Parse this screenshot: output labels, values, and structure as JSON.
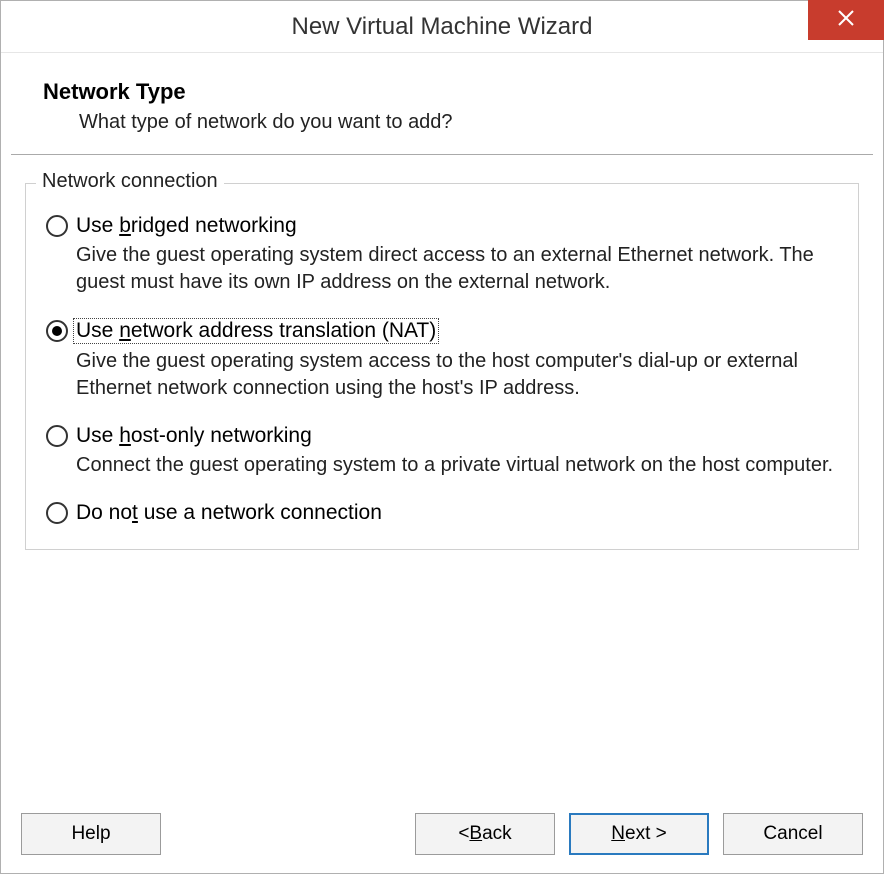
{
  "window": {
    "title": "New Virtual Machine Wizard"
  },
  "header": {
    "heading": "Network Type",
    "subtitle": "What type of network do you want to add?"
  },
  "group": {
    "legend": "Network connection",
    "options": [
      {
        "label_pre": "Use ",
        "mnemonic": "b",
        "label_post": "ridged networking",
        "description": "Give the guest operating system direct access to an external Ethernet network. The guest must have its own IP address on the external network.",
        "selected": false,
        "focused": false
      },
      {
        "label_pre": "Use ",
        "mnemonic": "n",
        "label_post": "etwork address translation (NAT)",
        "description": "Give the guest operating system access to the host computer's dial-up or external Ethernet network connection using the host's IP address.",
        "selected": true,
        "focused": true
      },
      {
        "label_pre": "Use ",
        "mnemonic": "h",
        "label_post": "ost-only networking",
        "description": "Connect the guest operating system to a private virtual network on the host computer.",
        "selected": false,
        "focused": false
      },
      {
        "label_pre": "Do no",
        "mnemonic": "t",
        "label_post": " use a network connection",
        "description": "",
        "selected": false,
        "focused": false
      }
    ]
  },
  "buttons": {
    "help": "Help",
    "back_pre": "< ",
    "back_m": "B",
    "back_post": "ack",
    "next_pre": "",
    "next_m": "N",
    "next_post": "ext >",
    "cancel": "Cancel"
  }
}
